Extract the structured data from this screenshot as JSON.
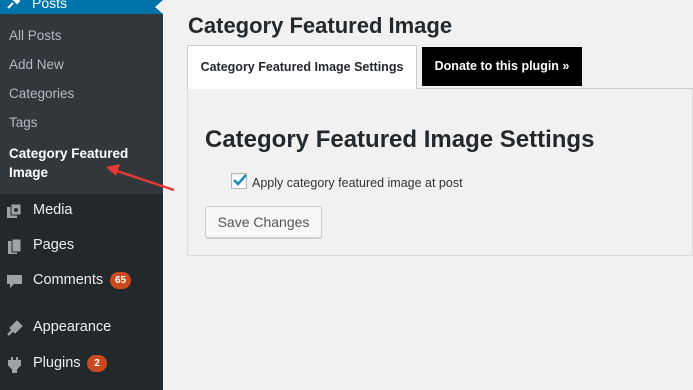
{
  "sidebar": {
    "posts_label": "Posts",
    "submenu": [
      "All Posts",
      "Add New",
      "Categories",
      "Tags"
    ],
    "current_item": "Category Featured Image",
    "items": [
      {
        "label": "Media",
        "icon": "media-icon"
      },
      {
        "label": "Pages",
        "icon": "pages-icon"
      },
      {
        "label": "Comments",
        "icon": "comments-icon",
        "badge": "65"
      },
      {
        "label": "Appearance",
        "icon": "appearance-icon"
      },
      {
        "label": "Plugins",
        "icon": "plugins-icon",
        "badge": "2"
      }
    ]
  },
  "main": {
    "title": "Category Featured Image",
    "tabs": [
      {
        "label": "Category Featured Image Settings",
        "active": true
      },
      {
        "label": "Donate to this plugin »",
        "active": false
      }
    ],
    "section_title": "Category Featured Image Settings",
    "checkbox_label": "Apply category featured image at post",
    "checkbox_checked": true,
    "save_label": "Save Changes"
  },
  "colors": {
    "sidebar_bg": "#23282d",
    "submenu_bg": "#32373c",
    "accent": "#0073aa",
    "badge": "#ca4a1f",
    "annotation_arrow": "#e53935"
  }
}
